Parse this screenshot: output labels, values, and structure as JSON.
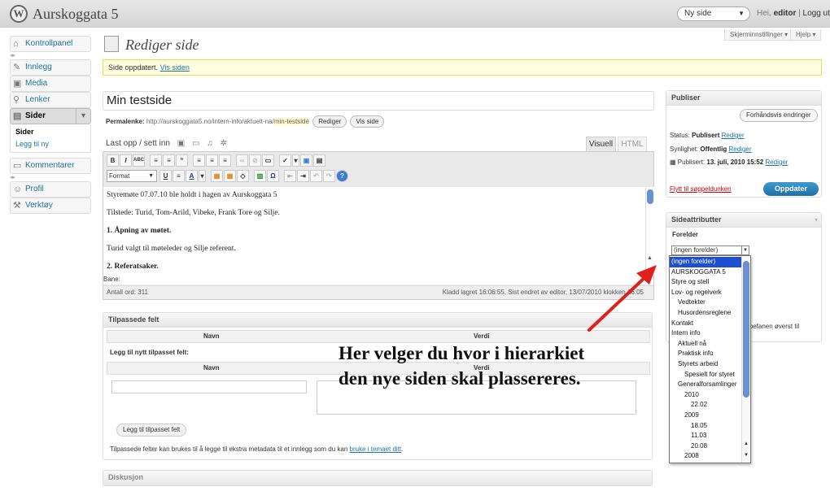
{
  "header": {
    "site_title": "Aurskoggata 5",
    "logo_letter": "W",
    "new_page_select": "Ny side",
    "howdy_prefix": "Hei,",
    "user": "editor",
    "separator": "|",
    "logout": "Logg ut"
  },
  "screen_options": "Skjerminnstillinger",
  "help": "Hjelp",
  "sidebar": {
    "items": [
      {
        "label": "Kontrollpanel",
        "icon": "dashboard-icon"
      },
      {
        "label": "Innlegg",
        "icon": "pin-icon"
      },
      {
        "label": "Media",
        "icon": "media-icon"
      },
      {
        "label": "Lenker",
        "icon": "links-icon"
      },
      {
        "label": "Sider",
        "icon": "pages-icon"
      },
      {
        "label": "Kommentarer",
        "icon": "comments-icon"
      },
      {
        "label": "Profil",
        "icon": "profile-icon"
      },
      {
        "label": "Verktøy",
        "icon": "tools-icon"
      }
    ],
    "submenu": [
      "Sider",
      "Legg til ny"
    ]
  },
  "page_title": "Rediger side",
  "notice": {
    "text": "Side oppdatert.",
    "link": "Vis siden"
  },
  "post_title": "Min testside",
  "permalink": {
    "label": "Permalenke:",
    "url": "http://aurskoggata5.no/intern-info/aktuelt-na/",
    "slug": "min-testside",
    "edit_btn": "Rediger",
    "view_btn": "Vis side"
  },
  "upload_label": "Last opp / sett inn",
  "editor_tabs": {
    "visual": "Visuell",
    "html": "HTML"
  },
  "toolbar": {
    "format": "Format",
    "buttons1": [
      "B",
      "I",
      "ABC",
      "≡",
      "≡",
      "“",
      "≡",
      "≡",
      "≡",
      "∞",
      "⊘",
      "▭",
      "✓",
      "▾",
      "▣",
      "▤"
    ],
    "buttons2": [
      "U",
      "≡",
      "A",
      "▾",
      "▦",
      "▦",
      "◇",
      "▥",
      "Ω",
      "⇤",
      "⇥",
      "↶",
      "↷",
      "?"
    ]
  },
  "content": [
    {
      "text": "Styremøte 07.07.10 ble holdt i hagen av Aurskoggata 5",
      "bold": false
    },
    {
      "text": "Tilstede: Turid, Tom-Arild, Vibeke, Frank Tore og Silje.",
      "bold": false
    },
    {
      "text": "1. Åpning av møtet.",
      "bold": true
    },
    {
      "text": "Turid valgt til møteleder og Silje referent.",
      "bold": false
    },
    {
      "text": "2. Referatsaker.",
      "bold": true
    }
  ],
  "path_label": "Bane:",
  "word_count": "Antall ord: 311",
  "draft_saved": "Kladd lagret 16:06:55. Sist endret av editor, 13/07/2010 klokken 16:05",
  "custom_fields": {
    "title": "Tilpassede felt",
    "col_name": "Navn",
    "col_value": "Verdi",
    "add_new": "Legg til nytt tilpasset felt:",
    "add_btn": "Legg til tilpasset felt",
    "note": "Tilpassede felter kan brukes til å legge til ekstra metadata til et innlegg som du kan",
    "note_link": "bruke i temaet ditt",
    "note_end": "."
  },
  "discussion_title": "Diskusjon",
  "publish": {
    "title": "Publiser",
    "preview_btn": "Forhåndsvis endringer",
    "status_label": "Status:",
    "status_value": "Publisert",
    "status_edit": "Rediger",
    "visibility_label": "Synlighet:",
    "visibility_value": "Offentlig",
    "visibility_edit": "Rediger",
    "published_label": "Publisert:",
    "published_value": "13. juli, 2010 15:52",
    "published_edit": "Rediger",
    "trash": "Flytt til søppeldunken",
    "update_btn": "Oppdater"
  },
  "attributes": {
    "title": "Sideattributter",
    "parent_label": "Forelder",
    "parent_value": "(ingen forelder)",
    "help_fragment": "lpefanen øverst til"
  },
  "parent_options": [
    {
      "label": "(ingen forelder)",
      "indent": 0
    },
    {
      "label": "AURSKOGGATA 5",
      "indent": 0
    },
    {
      "label": "Styre og stell",
      "indent": 0
    },
    {
      "label": "Lov- og regelverk",
      "indent": 0
    },
    {
      "label": "Vedtekter",
      "indent": 1
    },
    {
      "label": "Husordensreglene",
      "indent": 1
    },
    {
      "label": "Kontakt",
      "indent": 0
    },
    {
      "label": "Intern info",
      "indent": 0
    },
    {
      "label": "Aktuell nå",
      "indent": 1
    },
    {
      "label": "Praktisk info",
      "indent": 1
    },
    {
      "label": "Styrets arbeid",
      "indent": 1
    },
    {
      "label": "Spesielt for styret",
      "indent": 2
    },
    {
      "label": "Generalforsamlinger",
      "indent": 1
    },
    {
      "label": "2010",
      "indent": 2
    },
    {
      "label": "22.02",
      "indent": 3
    },
    {
      "label": "2009",
      "indent": 2
    },
    {
      "label": "18.05",
      "indent": 3
    },
    {
      "label": "11.03",
      "indent": 3
    },
    {
      "label": "20.08",
      "indent": 3
    },
    {
      "label": "2008",
      "indent": 2
    }
  ],
  "annotation": {
    "line1": "Her velger du hvor i hierarkiet",
    "line2": "den nye siden skal plassereres.",
    "arrow_color": "#e0201c"
  },
  "colors": {
    "link": "#21759b",
    "update_button": "#1e6fa6",
    "notice_bg": "#ffffe0",
    "selection": "#1f4fcf"
  }
}
